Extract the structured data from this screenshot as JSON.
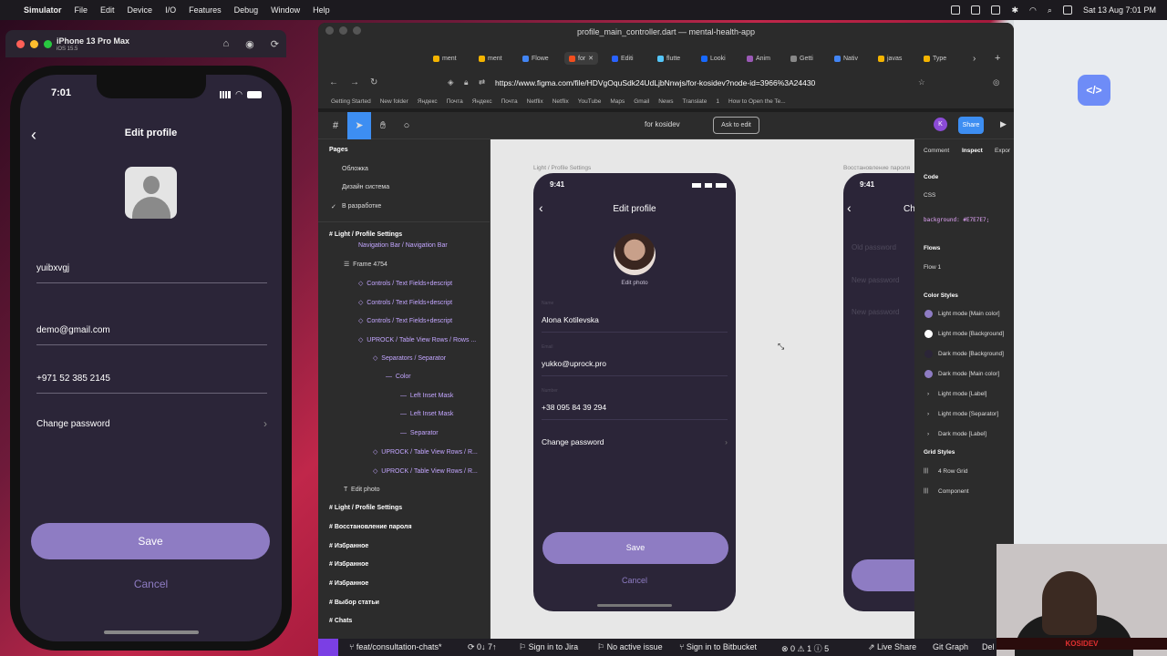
{
  "menubar": {
    "app": "Simulator",
    "items": [
      "File",
      "Edit",
      "Device",
      "I/O",
      "Features",
      "Debug",
      "Window",
      "Help"
    ],
    "datetime": "Sat 13 Aug  7:01 PM"
  },
  "simulator": {
    "device": "iPhone 13 Pro Max",
    "os": "iOS 15.5"
  },
  "phone": {
    "time": "7:01",
    "title": "Edit profile",
    "name_value": "yuibxvgj",
    "email_value": "demo@gmail.com",
    "phone_value": "+971 52 385 2145",
    "change_password": "Change password",
    "save": "Save",
    "cancel": "Cancel"
  },
  "browser": {
    "window_title": "profile_main_controller.dart — mental-health-app",
    "url": "https://www.figma.com/file/HDVgOquSdk24UdLjbNnwjs/for-kosidev?node-id=3966%3A24430",
    "tabs": [
      "ment",
      "ment",
      "Flowe",
      "for",
      "Editi",
      "flutte",
      "Looki",
      "Anim",
      "Getti",
      "Nativ",
      "javas",
      "Type"
    ],
    "bookmarks": [
      "Getting Started",
      "New folder",
      "Яндекс",
      "Почта",
      "Яндекс",
      "Почта",
      "Netflix",
      "Netflix",
      "YouTube",
      "Maps",
      "Gmail",
      "News",
      "Translate",
      "1",
      "How to Open the Te..."
    ]
  },
  "figma": {
    "file_name": "for kosidev",
    "ask_to_edit": "Ask to edit",
    "share": "Share",
    "avatar_letter": "K",
    "pages_title": "Pages",
    "pages": [
      "Обложка",
      "Дизайн система",
      "В разработке"
    ],
    "layers": [
      "Light / Profile Settings",
      "Navigation Bar / Navigation Bar",
      "Frame 4754",
      "Controls / Text Fields+descript",
      "Controls / Text Fields+descript",
      "Controls / Text Fields+descript",
      "UPROCK / Table View Rows / Rows ...",
      "Separators / Separator",
      "Color",
      "Left Inset Mask",
      "Left Inset Mask",
      "Separator",
      "UPROCK / Table View Rows / R...",
      "UPROCK / Table View Rows / R...",
      "Edit photo",
      "Light / Profile Settings",
      "Восстановление пароля",
      "Избранное",
      "Избранное",
      "Избранное",
      "Выбор статьи",
      "Chats"
    ],
    "frame1_label": "Light / Profile Settings",
    "frame2_label": "Восстановление пароля",
    "f_time": "9:41",
    "f_title": "Edit profile",
    "f_edit_photo": "Edit photo",
    "f_name_label": "Name",
    "f_name": "Alona Kotilevska",
    "f_email_label": "Email",
    "f_email": "yukko@uprock.pro",
    "f_number_label": "Number",
    "f_number": "+38 095 84 39 294",
    "f_change": "Change password",
    "f_save": "Save",
    "f_cancel": "Cancel",
    "f2_title": "Ch",
    "f2_old": "Old password",
    "f2_new": "New password",
    "f2_new2": "New password",
    "inspect_tabs": [
      "Comment",
      "Inspect",
      "Expor"
    ],
    "code_title": "Code",
    "code_lang": "CSS",
    "code_line": "background: #E7E7E7;",
    "flows_title": "Flows",
    "flow1": "Flow 1",
    "color_styles_title": "Color Styles",
    "color_styles": [
      "Light mode [Main color]",
      "Light mode [Background]",
      "Dark mode [Background]",
      "Dark mode [Main color]",
      "Light mode [Label]",
      "Light mode [Separator]",
      "Dark mode [Label]"
    ],
    "grid_styles_title": "Grid Styles",
    "grid_styles": [
      "4 Row Grid",
      "Component"
    ]
  },
  "statusbar": {
    "branch": "feat/consultation-chats*",
    "sync": "0↓ 7↑",
    "jira": "Sign in to Jira",
    "issue": "No active issue",
    "bitbucket": "Sign in to Bitbucket",
    "problems": "⊗ 0 ⚠ 1 ⓘ 5",
    "live": "Live Share",
    "graph": "Git Graph",
    "del": "Del"
  },
  "webcam": {
    "name": "KOSIDEV"
  },
  "colors": {
    "accent": "#8e7cc3",
    "phone_bg": "#2b2538",
    "figma_blue": "#3d8ef2"
  }
}
